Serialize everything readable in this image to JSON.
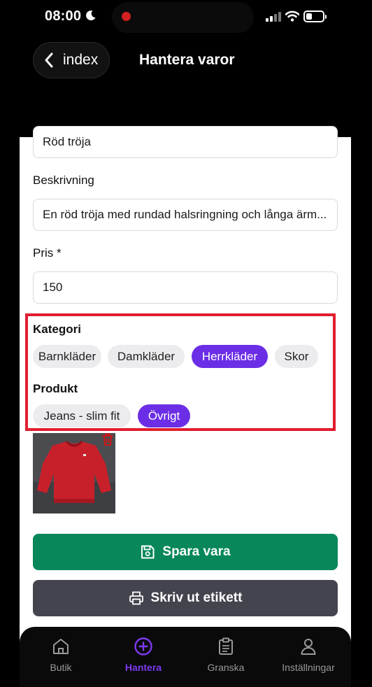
{
  "status_bar": {
    "time": "08:00"
  },
  "header": {
    "back_label": "index",
    "title": "Hantera varor"
  },
  "form": {
    "name_value": "Röd tröja",
    "description_label": "Beskrivning",
    "description_value": "En röd tröja med rundad halsringning och långa ärm...",
    "price_label": "Pris *",
    "price_value": "150"
  },
  "category": {
    "label": "Kategori",
    "options": [
      "Barnkläder",
      "Damkläder",
      "Herrkläder",
      "Skor"
    ],
    "selected": "Herrkläder"
  },
  "product": {
    "label": "Produkt",
    "options": [
      "Jeans - slim fit",
      "Övrigt"
    ],
    "selected": "Övrigt"
  },
  "actions": {
    "save_label": "Spara vara",
    "print_label": "Skriv ut etikett"
  },
  "tabs": [
    {
      "label": "Butik",
      "icon": "home-icon"
    },
    {
      "label": "Hantera",
      "icon": "plus-circle-icon",
      "active": true
    },
    {
      "label": "Granska",
      "icon": "clipboard-icon"
    },
    {
      "label": "Inställningar",
      "icon": "user-icon"
    }
  ],
  "colors": {
    "accent": "#6b2ee6",
    "save": "#07875a",
    "print": "#44444f",
    "highlight": "#e11d2e"
  }
}
